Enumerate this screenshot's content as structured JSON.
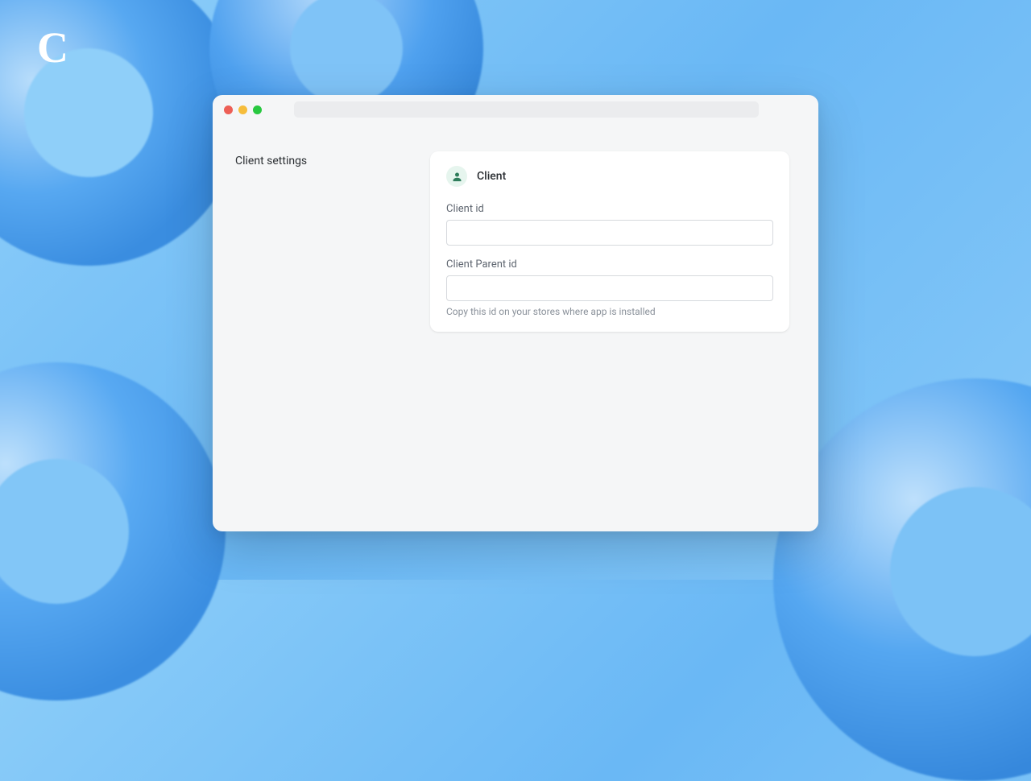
{
  "logo": "C",
  "sidebar": {
    "title": "Client settings"
  },
  "card": {
    "title": "Client",
    "fields": {
      "client_id": {
        "label": "Client id",
        "value": ""
      },
      "client_parent_id": {
        "label": "Client Parent id",
        "value": "",
        "help": "Copy this id on your stores where app is installed"
      }
    }
  }
}
